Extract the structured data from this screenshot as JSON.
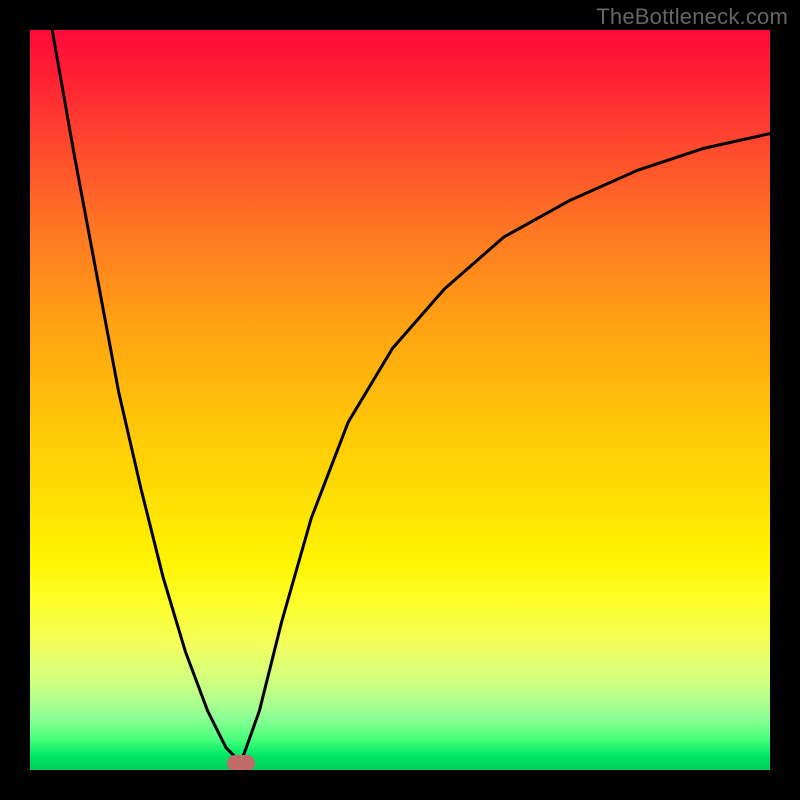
{
  "watermark": "TheBottleneck.com",
  "chart_data": {
    "type": "line",
    "title": "",
    "xlabel": "",
    "ylabel": "",
    "xlim": [
      0,
      100
    ],
    "ylim": [
      0,
      100
    ],
    "grid": false,
    "legend": false,
    "series": [
      {
        "name": "left-branch",
        "x": [
          3,
          6,
          9,
          12,
          15,
          18,
          21,
          24,
          26.5,
          28.5
        ],
        "y": [
          100,
          83,
          67,
          51,
          38,
          26,
          16,
          8,
          3,
          1
        ]
      },
      {
        "name": "right-branch",
        "x": [
          28.5,
          31,
          34,
          38,
          43,
          49,
          56,
          64,
          73,
          82,
          91,
          100
        ],
        "y": [
          1,
          8,
          20,
          34,
          47,
          57,
          65,
          72,
          77,
          81,
          84,
          86
        ]
      }
    ],
    "annotations": [
      {
        "name": "minimum-marker",
        "x": 28.5,
        "y": 1,
        "color": "#c06a6a"
      }
    ],
    "colors": {
      "curve": "#000000",
      "background_top": "#ff0a3a",
      "background_bottom": "#00d05a",
      "frame": "#000000"
    }
  },
  "layout": {
    "image_size": 800,
    "frame_inset": 30
  }
}
